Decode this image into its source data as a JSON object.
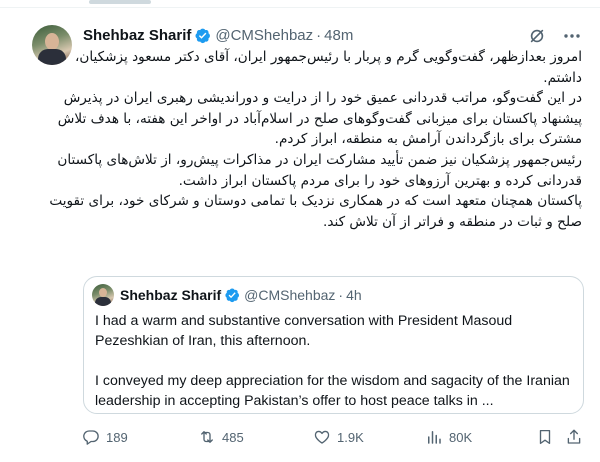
{
  "tweet": {
    "author_name": "Shehbaz Sharif",
    "handle": "@CMShehbaz",
    "separator": "·",
    "time": "48m",
    "paragraphs": [
      "امروز بعدازظهر، گفت‌وگویی گرم و پربار با رئیس‌جمهور ایران، آقای دکتر مسعود پزشکیان، داشتم.",
      "در این گفت‌وگو، مراتب قدردانی عمیق خود را از درایت و دوراندیشی رهبری ایران در پذیرش پیشنهاد پاکستان برای میزبانی گفت‌وگوهای صلح در اسلام‌آباد در اواخر این هفته، با هدف تلاش مشترک برای بازگرداندن آرامش به منطقه، ابراز کردم.",
      "رئیس‌جمهور پزشکیان نیز ضمن تأیید مشارکت ایران در مذاکرات پیش‌رو، از تلاش‌های پاکستان قدردانی کرده و بهترین آرزوهای خود را برای مردم پاکستان ابراز داشت.",
      "پاکستان همچنان متعهد است که در همکاری نزدیک با تمامی دوستان و شرکای خود، برای تقویت صلح و ثبات در منطقه و فراتر از آن تلاش کند."
    ]
  },
  "quote": {
    "author_name": "Shehbaz Sharif",
    "handle": "@CMShehbaz",
    "separator": "·",
    "time": "4h",
    "paragraph1": "I had a warm and substantive conversation with President  Masoud Pezeshkian of Iran, this afternoon.",
    "paragraph2": "I conveyed my deep appreciation for the wisdom and sagacity of the Iranian leadership in accepting Pakistan’s offer to host peace talks in ..."
  },
  "actions": {
    "replies": "189",
    "retweets": "485",
    "likes": "1.9K",
    "views": "80K"
  },
  "icons": {
    "verified": "verified-badge-icon",
    "grok": "grok-icon",
    "more": "more-icon",
    "reply": "reply-icon",
    "retweet": "retweet-icon",
    "like": "like-icon",
    "views": "views-icon",
    "bookmark": "bookmark-icon",
    "share": "share-icon"
  },
  "colors": {
    "verified": "#1d9bf0",
    "secondary_text": "#536471",
    "border": "#cfd9de"
  }
}
